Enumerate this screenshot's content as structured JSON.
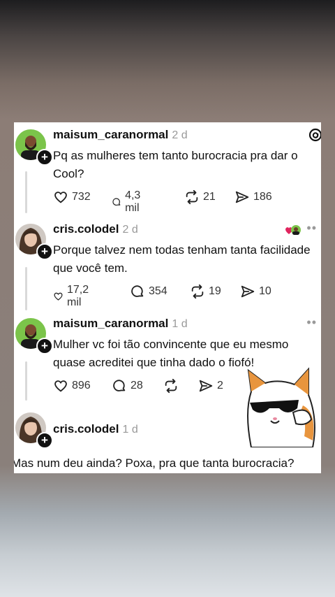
{
  "posts": [
    {
      "username": "maisum_caranormal",
      "time": "2 d",
      "text": "Pq as mulheres tem tanto burocracia pra dar o Cool?",
      "likes": "732",
      "comments": "4,3 mil",
      "reposts": "21",
      "shares": "186"
    },
    {
      "username": "cris.colodel",
      "time": "2 d",
      "text": "Porque talvez nem todas tenham tanta facilidade que você tem.",
      "likes": "17,2 mil",
      "comments": "354",
      "reposts": "19",
      "shares": "10"
    },
    {
      "username": "maisum_caranormal",
      "time": "1 d",
      "text": "Mulher vc foi tão convincente que eu mesmo quase acreditei que tinha dado o fiofó!",
      "likes": "896",
      "comments": "28",
      "reposts": "",
      "shares": "2"
    },
    {
      "username": "cris.colodel",
      "time": "1 d",
      "text": "Mas num deu ainda? Poxa, pra que tanta burocracia?"
    }
  ],
  "more_label": "••",
  "follow_symbol": "+",
  "colors": {
    "background": "#ffffff",
    "text": "#111111",
    "muted": "#999999",
    "thread_line": "#d9d9d9"
  },
  "icons": [
    "heart-icon",
    "comment-icon",
    "repost-icon",
    "share-icon",
    "threads-logo-icon",
    "more-icon",
    "follow-plus-icon"
  ]
}
